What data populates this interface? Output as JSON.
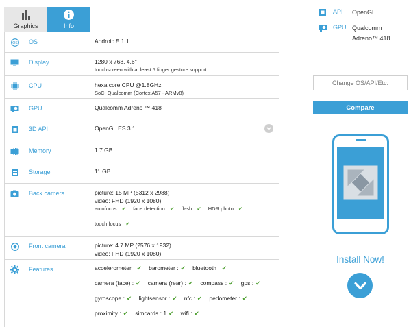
{
  "tabs": [
    {
      "label": "Graphics"
    },
    {
      "label": "Info"
    }
  ],
  "spec": {
    "os": {
      "label": "OS",
      "value": "Android 5.1.1"
    },
    "display": {
      "label": "Display",
      "value": "1280 x 768, 4.6\"",
      "sub": "touchscreen with at least 5 finger gesture support"
    },
    "cpu": {
      "label": "CPU",
      "value": "hexa core CPU @1.8GHz",
      "sub": "SoC: Qualcomm (Cortex A57 - ARMv8)"
    },
    "gpu": {
      "label": "GPU",
      "value": "Qualcomm Adreno ™ 418"
    },
    "api3d": {
      "label": "3D API",
      "value": "OpenGL ES 3.1"
    },
    "memory": {
      "label": "Memory",
      "value": "1.7 GB"
    },
    "storage": {
      "label": "Storage",
      "value": "11 GB"
    },
    "back_camera": {
      "label": "Back camera",
      "picture": "picture: 15 MP (5312 x 2988)",
      "video": "video: FHD (1920 x 1080)",
      "features": [
        "autofocus :",
        "face detection :",
        "flash :",
        "HDR photo :"
      ],
      "features2": [
        "touch focus :"
      ]
    },
    "front_camera": {
      "label": "Front camera",
      "picture": "picture: 4.7 MP (2576 x 1932)",
      "video": "video: FHD (1920 x 1080)"
    },
    "features": {
      "label": "Features",
      "lines": [
        [
          "accelerometer :",
          "barometer :",
          "bluetooth :"
        ],
        [
          "camera (face) :",
          "camera (rear) :",
          "compass :",
          "gps :"
        ],
        [
          "gyroscope :",
          "lightsensor :",
          "nfc :",
          "pedometer :"
        ],
        [
          "proximity :",
          "simcards : 1",
          "wifi :"
        ]
      ]
    }
  },
  "sidebar": {
    "api_key": "API",
    "api_value": "OpenGL",
    "gpu_key": "GPU",
    "gpu_value_1": "Qualcomm",
    "gpu_value_2": "Adreno™ 418",
    "change_label": "Change OS/API/Etc.",
    "compare_label": "Compare",
    "install_label": "Install Now!"
  },
  "colors": {
    "accent": "#3b9fd6",
    "check": "#4c9e2f"
  },
  "icons": [
    "graphics-bars-icon",
    "info-icon",
    "os-icon",
    "display-icon",
    "cpu-icon",
    "gpu-icon",
    "3d-api-icon",
    "memory-icon",
    "storage-icon",
    "camera-icon",
    "front-camera-icon",
    "features-gear-icon",
    "chevron-down-icon",
    "download-chevron-icon",
    "phone-illustration"
  ]
}
